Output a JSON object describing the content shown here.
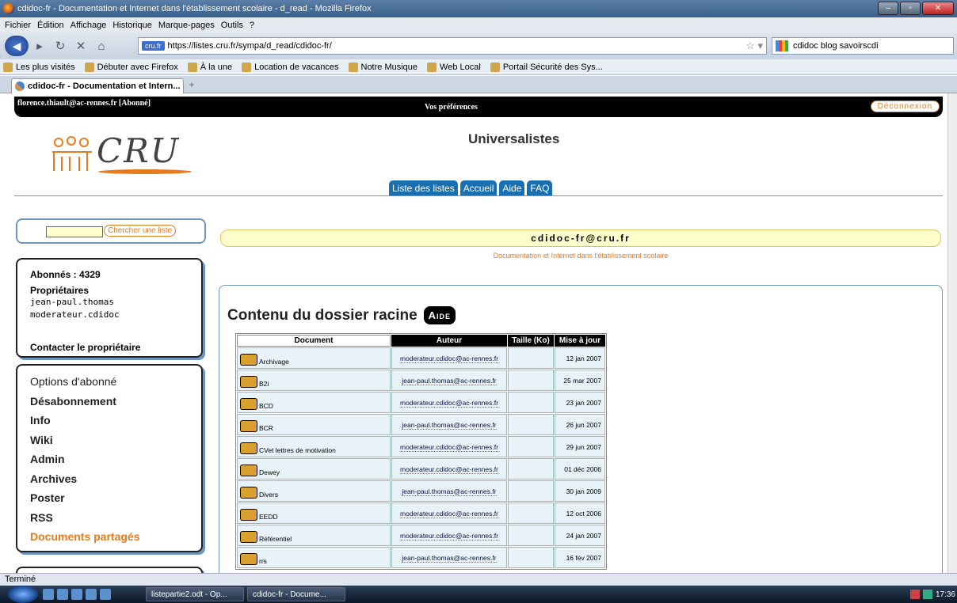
{
  "window": {
    "title": "cdidoc-fr - Documentation et Internet dans l'établissement scolaire - d_read - Mozilla Firefox"
  },
  "menu": [
    "Fichier",
    "Édition",
    "Affichage",
    "Historique",
    "Marque-pages",
    "Outils",
    "?"
  ],
  "nav": {
    "url_badge": "cru.fr",
    "url": "https://listes.cru.fr/sympa/d_read/cdidoc-fr/",
    "search": "cdidoc blog savoirscdi"
  },
  "bookmarks": [
    "Les plus visités",
    "Débuter avec Firefox",
    "À la une",
    "Location de vacances",
    "Notre Musique",
    "Web Local",
    "Portail Sécurité des Sys..."
  ],
  "tab": {
    "label": "cdidoc-fr - Documentation et Intern...",
    "plus": "+"
  },
  "topbar": {
    "user": "florence.thiault@ac-rennes.fr [Abonné]",
    "prefs": "Vos préférences",
    "logout": "Déconnexion"
  },
  "site": {
    "logo_text": "CRU",
    "title": "Universalistes",
    "tabs": [
      "Liste des listes",
      "Accueil",
      "Aide",
      "FAQ"
    ]
  },
  "search": {
    "button": "Chercher une liste",
    "value": ""
  },
  "info": {
    "subscribers": "Abonnés : 4329",
    "owners_label": "Propriétaires",
    "owners": [
      "jean-paul.thomas",
      "moderateur.cdidoc"
    ],
    "contact": "Contacter le propriétaire"
  },
  "sidemenu": [
    "Options d'abonné",
    "Désabonnement",
    "Info",
    "Wiki",
    "Admin",
    "Archives",
    "Poster",
    "RSS",
    "Documents partagés"
  ],
  "list": {
    "address": "cdidoc-fr@cru.fr",
    "description": "Documentation et Internet dans l'établissement scolaire"
  },
  "content": {
    "title": "Contenu du dossier racine",
    "aide": "Aide",
    "columns": [
      "Document",
      "Auteur",
      "Taille (Ko)",
      "Mise à jour"
    ],
    "rows": [
      {
        "name": "Archivage",
        "author": "moderateur.cdidoc@ac-rennes.fr",
        "size": "",
        "date": "12 jan 2007"
      },
      {
        "name": "B2i",
        "author": "jean-paul.thomas@ac-rennes.fr",
        "size": "",
        "date": "25 mar 2007"
      },
      {
        "name": "BCD",
        "author": "moderateur.cdidoc@ac-rennes.fr",
        "size": "",
        "date": "23 jan 2007"
      },
      {
        "name": "BCR",
        "author": "jean-paul.thomas@ac-rennes.fr",
        "size": "",
        "date": "26 jun 2007"
      },
      {
        "name": "CVet lettres de motivation",
        "author": "moderateur.cdidoc@ac-rennes.fr",
        "size": "",
        "date": "29 jun 2007"
      },
      {
        "name": "Dewey",
        "author": "moderateur.cdidoc@ac-rennes.fr",
        "size": "",
        "date": "01 déc 2006"
      },
      {
        "name": "Divers",
        "author": "jean-paul.thomas@ac-rennes.fr",
        "size": "",
        "date": "30 jan 2009"
      },
      {
        "name": "EEDD",
        "author": "moderateur.cdidoc@ac-rennes.fr",
        "size": "",
        "date": "12 oct 2006"
      },
      {
        "name": "Référentiel",
        "author": "moderateur.cdidoc@ac-rennes.fr",
        "size": "",
        "date": "24 jan 2007"
      },
      {
        "name": "rrs",
        "author": "jean-paul.thomas@ac-rennes.fr",
        "size": "",
        "date": "16 fév 2007"
      }
    ]
  },
  "status": "Terminé",
  "taskbar": {
    "items": [
      "listepartie2.odt - Op...",
      "cdidoc-fr - Docume..."
    ],
    "clock": "17:36"
  }
}
